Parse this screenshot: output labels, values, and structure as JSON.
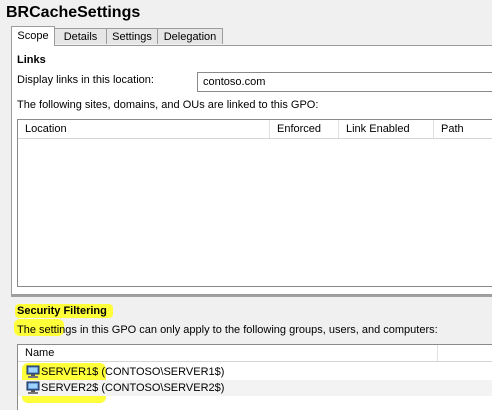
{
  "window": {
    "title": "BRCacheSettings"
  },
  "tabs": [
    {
      "label": "Scope",
      "active": true
    },
    {
      "label": "Details",
      "active": false
    },
    {
      "label": "Settings",
      "active": false
    },
    {
      "label": "Delegation",
      "active": false
    }
  ],
  "links": {
    "title": "Links",
    "display_label": "Display links in this location:",
    "location_value": "contoso.com",
    "description": "The following sites, domains, and OUs are linked to this GPO:",
    "columns": [
      "Location",
      "Enforced",
      "Link Enabled",
      "Path"
    ],
    "rows": []
  },
  "security": {
    "title": "Security Filtering",
    "description": "The settings in this GPO can only apply to the following groups, users, and computers:",
    "column": "Name",
    "entries": [
      {
        "name": "SERVER1$",
        "path": " (CONTOSO\\SERVER1$)",
        "icon": "computer-icon"
      },
      {
        "name": "SERVER2$",
        "path": " (CONTOSO\\SERVER2$)",
        "icon": "computer-icon"
      }
    ]
  },
  "colors": {
    "highlight": "#ffff3a",
    "background": "#f0f0f0"
  }
}
